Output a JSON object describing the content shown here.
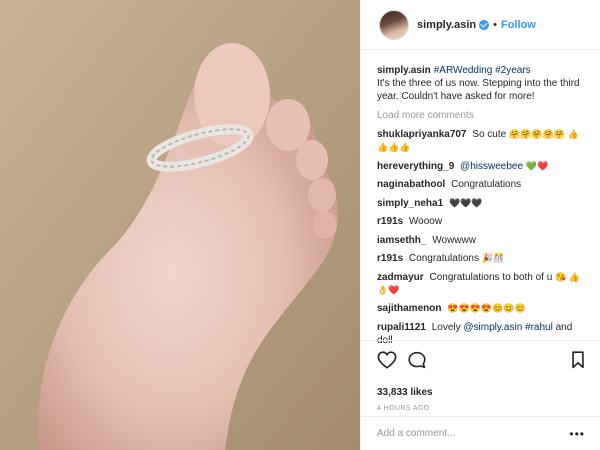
{
  "post": {
    "username": "simply.asin",
    "separator": "•",
    "follow_label": "Follow",
    "caption_user": "simply.asin",
    "caption_tags": "#ARWedding #2years",
    "caption_text": "It's the three of us now. Stepping into the third year. Couldn't have asked for more!",
    "load_more": "Load more comments",
    "comments": [
      {
        "user": "shuklapriyanka707",
        "text": "So cute",
        "emoji": "🤗🤗🤗🤗🤗 👍👍👍👍"
      },
      {
        "user": "hereverything_9",
        "mention": "@hissweebee",
        "emoji": "💚❤️"
      },
      {
        "user": "naginabathool",
        "text": "Congratulations"
      },
      {
        "user": "simply_neha1",
        "emoji": "🖤🖤🖤"
      },
      {
        "user": "r191s",
        "text": "Wooow"
      },
      {
        "user": "iamsethh_",
        "text": "Wowwww"
      },
      {
        "user": "r191s",
        "text": "Congratulations",
        "emoji": "🎉🎊"
      },
      {
        "user": "zadmayur",
        "text": "Congratulations to both of u",
        "emoji": "😘 👍👌❤️"
      },
      {
        "user": "sajithamenon",
        "emoji": "😍😍😍😍😊😊😊"
      },
      {
        "user": "rupali1121",
        "text": "Lovely",
        "mention": "@simply.asin #rahul",
        "text2": "and doll"
      }
    ],
    "likes": "33,833 likes",
    "time_ago": "4 HOURS AGO",
    "add_comment_placeholder": "Add a comment...",
    "more_symbol": "•••"
  },
  "icons": {
    "like": "heart-icon",
    "comment": "comment-bubble-icon",
    "save": "bookmark-icon",
    "verified": "verified-badge-icon",
    "more": "more-options-icon"
  },
  "colors": {
    "link": "#3897f0",
    "hashtag": "#003569",
    "muted": "#999999"
  }
}
